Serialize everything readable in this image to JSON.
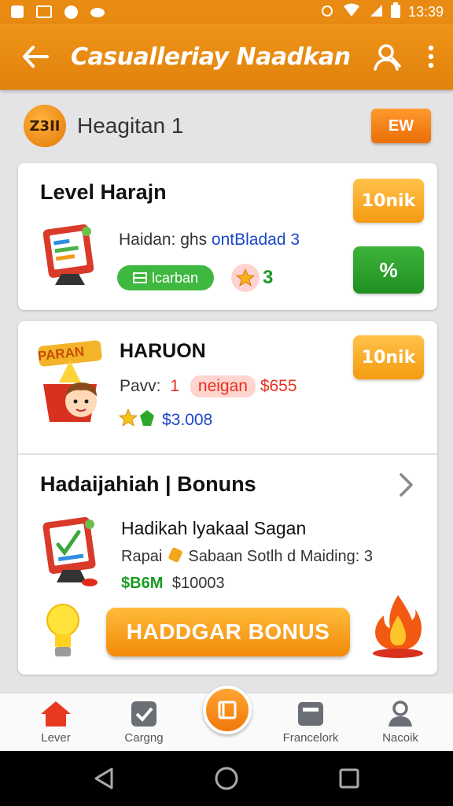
{
  "status_bar": {
    "time": "13:39"
  },
  "app_bar": {
    "title": "Casualleriay Naadkan"
  },
  "header": {
    "logo_text": "Z3II",
    "name": "Heagitan 1",
    "pill_label": "EW"
  },
  "card1": {
    "title": "Level Harajn",
    "badge_label": "10nik",
    "info_line": {
      "prefix": "Haidan: ghs ",
      "highlight": "ontBladad 3"
    },
    "chip_label": "lcarban",
    "star_count": "3",
    "action_label": "%"
  },
  "card2": {
    "sticker_text": "PARAN",
    "title": "HARUON",
    "badge_label": "10nik",
    "pay_line": {
      "prefix": "Pavv:",
      "num": "1",
      "chip": "neigan",
      "amount": "$655"
    },
    "value": "$3.008"
  },
  "card3": {
    "title": "Hadaijahiah | Bonuns",
    "subtitle": "Hadikah lyakaal Sagan",
    "detail_line": {
      "prefix": "Rapai",
      "rest": "Sabaan Sotlh d Maiding: 3"
    },
    "amount_green": "$B6M",
    "amount": "$10003",
    "button_label": "HADDGAR BONUS"
  },
  "bottom_nav": {
    "items": [
      {
        "label": "Lever"
      },
      {
        "label": "Cargng"
      },
      {
        "label": "Francelork"
      },
      {
        "label": "Nacoik"
      }
    ]
  },
  "colors": {
    "accent": "#ee9418",
    "green": "#3fb33b",
    "blue": "#1d47c9"
  }
}
